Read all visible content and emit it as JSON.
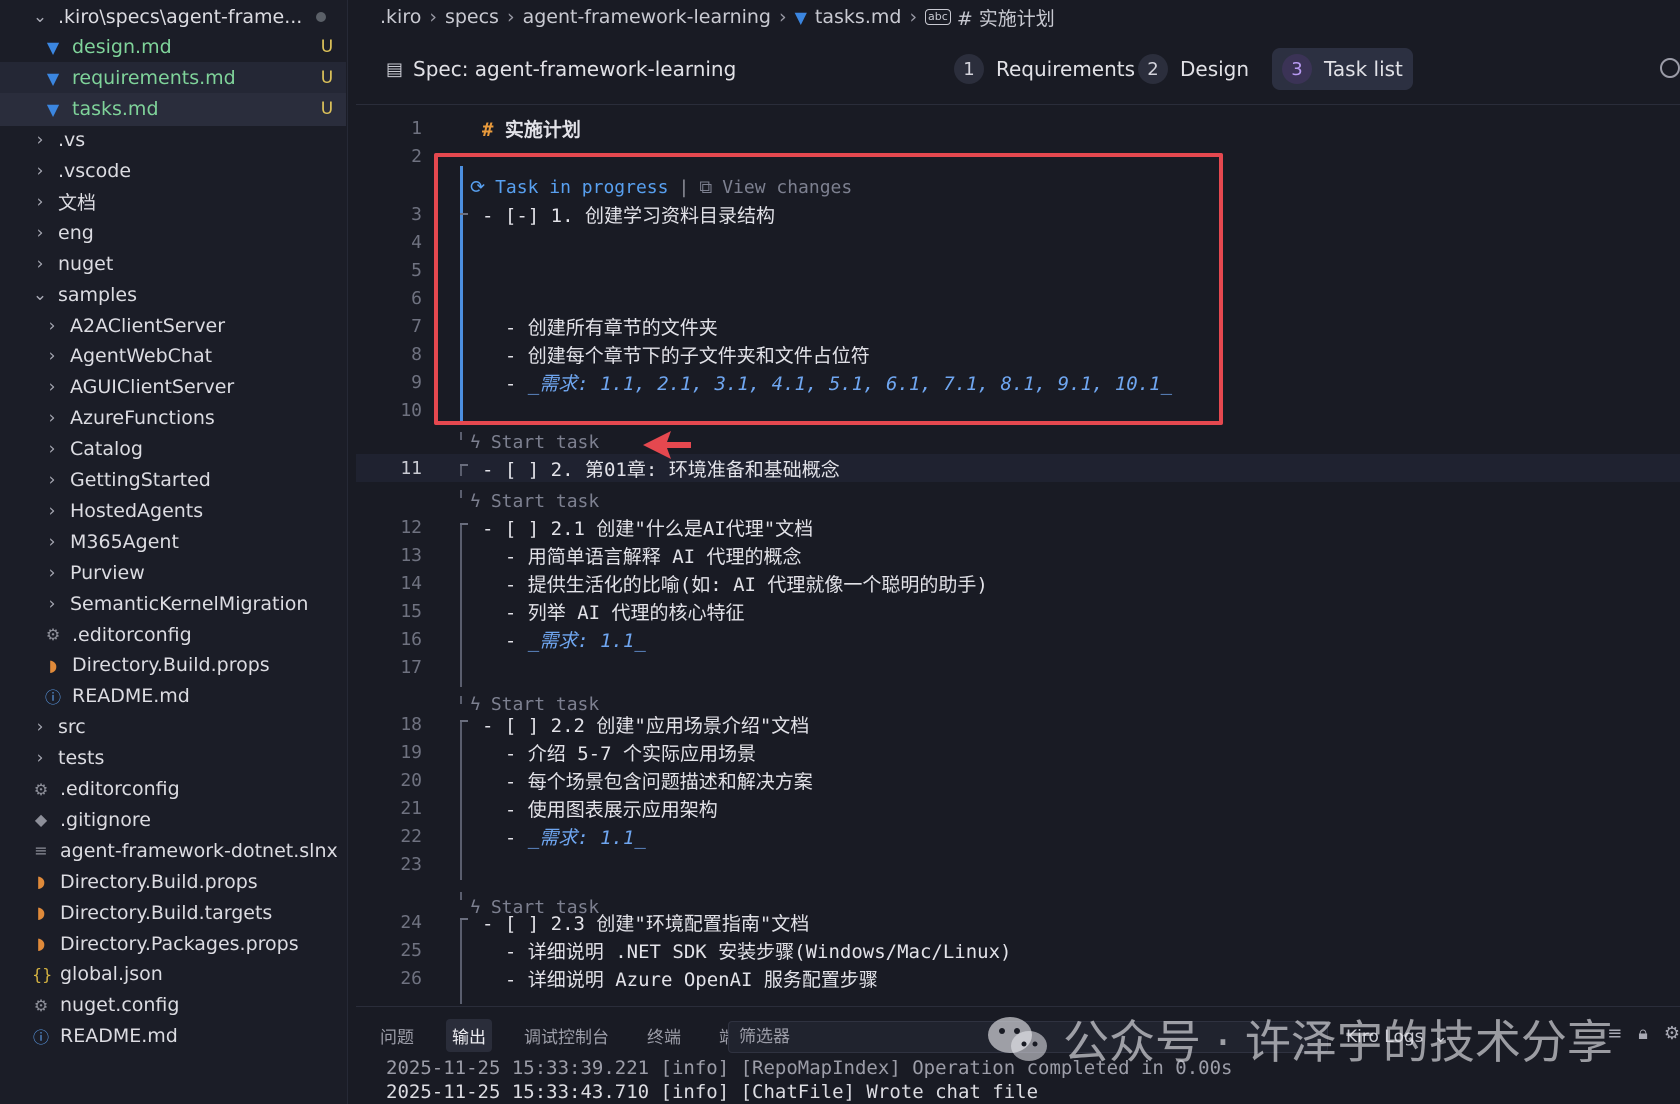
{
  "sidebar": {
    "items": [
      {
        "label": ".kiro\\specs\\agent-frame...",
        "kind": "folder-open",
        "indent": 1,
        "state": "modified"
      },
      {
        "label": "design.md",
        "kind": "md",
        "indent": 2,
        "badge": "U",
        "color": "green",
        "state": ""
      },
      {
        "label": "requirements.md",
        "kind": "md",
        "indent": 2,
        "badge": "U",
        "color": "green",
        "state": "hover"
      },
      {
        "label": "tasks.md",
        "kind": "md",
        "indent": 2,
        "badge": "U",
        "color": "green",
        "state": "active"
      },
      {
        "label": ".vs",
        "kind": "folder",
        "indent": 1
      },
      {
        "label": ".vscode",
        "kind": "folder",
        "indent": 1
      },
      {
        "label": "文档",
        "kind": "folder",
        "indent": 1
      },
      {
        "label": "eng",
        "kind": "folder",
        "indent": 1
      },
      {
        "label": "nuget",
        "kind": "folder",
        "indent": 1
      },
      {
        "label": "samples",
        "kind": "folder-open",
        "indent": 1
      },
      {
        "label": "A2AClientServer",
        "kind": "folder",
        "indent": 2
      },
      {
        "label": "AgentWebChat",
        "kind": "folder",
        "indent": 2
      },
      {
        "label": "AGUIClientServer",
        "kind": "folder",
        "indent": 2
      },
      {
        "label": "AzureFunctions",
        "kind": "folder",
        "indent": 2
      },
      {
        "label": "Catalog",
        "kind": "folder",
        "indent": 2
      },
      {
        "label": "GettingStarted",
        "kind": "folder",
        "indent": 2
      },
      {
        "label": "HostedAgents",
        "kind": "folder",
        "indent": 2
      },
      {
        "label": "M365Agent",
        "kind": "folder",
        "indent": 2
      },
      {
        "label": "Purview",
        "kind": "folder",
        "indent": 2
      },
      {
        "label": "SemanticKernelMigration",
        "kind": "folder",
        "indent": 2
      },
      {
        "label": ".editorconfig",
        "kind": "gear",
        "indent": 2
      },
      {
        "label": "Directory.Build.props",
        "kind": "rss",
        "indent": 2
      },
      {
        "label": "README.md",
        "kind": "info",
        "indent": 2
      },
      {
        "label": "src",
        "kind": "folder",
        "indent": 1
      },
      {
        "label": "tests",
        "kind": "folder",
        "indent": 1
      },
      {
        "label": ".editorconfig",
        "kind": "gear",
        "indent": 1
      },
      {
        "label": ".gitignore",
        "kind": "diamond",
        "indent": 1
      },
      {
        "label": "agent-framework-dotnet.slnx",
        "kind": "list",
        "indent": 1
      },
      {
        "label": "Directory.Build.props",
        "kind": "rss",
        "indent": 1
      },
      {
        "label": "Directory.Build.targets",
        "kind": "rss",
        "indent": 1
      },
      {
        "label": "Directory.Packages.props",
        "kind": "rss",
        "indent": 1
      },
      {
        "label": "global.json",
        "kind": "json",
        "indent": 1
      },
      {
        "label": "nuget.config",
        "kind": "gear",
        "indent": 1
      },
      {
        "label": "README.md",
        "kind": "info",
        "indent": 1
      }
    ]
  },
  "breadcrumb": {
    "parts": [
      ".kiro",
      "specs",
      "agent-framework-learning",
      "tasks.md"
    ],
    "last": "# 实施计划"
  },
  "spec": {
    "title": "Spec: agent-framework-learning",
    "steps": [
      {
        "num": "1",
        "label": "Requirements"
      },
      {
        "num": "2",
        "label": "Design"
      },
      {
        "num": "3",
        "label": "Task list"
      }
    ],
    "active_step": 3
  },
  "codelens": {
    "in_progress": "Task in progress",
    "separator": "|",
    "view_changes": "View changes",
    "start_task": "Start task"
  },
  "editor": {
    "lines": [
      {
        "n": "1",
        "text": "实施计划",
        "type": "h1"
      },
      {
        "n": "2",
        "text": ""
      },
      {
        "n": "3",
        "text": "- [-] 1. 创建学习资料目录结构"
      },
      {
        "n": "4",
        "text": ""
      },
      {
        "n": "5",
        "text": ""
      },
      {
        "n": "6",
        "text": ""
      },
      {
        "n": "7",
        "text": "  - 创建所有章节的文件夹"
      },
      {
        "n": "8",
        "text": "  - 创建每个章节下的子文件夹和文件占位符"
      },
      {
        "n": "9",
        "text": "  - ",
        "req": "_需求: 1.1, 2.1, 3.1, 4.1, 5.1, 6.1, 7.1, 8.1, 9.1, 10.1_"
      },
      {
        "n": "10",
        "text": ""
      },
      {
        "n": "11",
        "text": "- [ ] 2. 第01章: 环境准备和基础概念",
        "current": true
      },
      {
        "n": "12",
        "text": "- [ ] 2.1 创建\"什么是AI代理\"文档"
      },
      {
        "n": "13",
        "text": "  - 用简单语言解释 AI 代理的概念"
      },
      {
        "n": "14",
        "text": "  - 提供生活化的比喻(如: AI 代理就像一个聪明的助手)"
      },
      {
        "n": "15",
        "text": "  - 列举 AI 代理的核心特征"
      },
      {
        "n": "16",
        "text": "  - ",
        "req": "_需求: 1.1_"
      },
      {
        "n": "17",
        "text": ""
      },
      {
        "n": "18",
        "text": "- [ ] 2.2 创建\"应用场景介绍\"文档"
      },
      {
        "n": "19",
        "text": "  - 介绍 5-7 个实际应用场景"
      },
      {
        "n": "20",
        "text": "  - 每个场景包含问题描述和解决方案"
      },
      {
        "n": "21",
        "text": "  - 使用图表展示应用架构"
      },
      {
        "n": "22",
        "text": "  - ",
        "req": "_需求: 1.1_"
      },
      {
        "n": "23",
        "text": ""
      },
      {
        "n": "24",
        "text": "- [ ] 2.3 创建\"环境配置指南\"文档"
      },
      {
        "n": "25",
        "text": "  - 详细说明 .NET SDK 安装步骤(Windows/Mac/Linux)"
      },
      {
        "n": "26",
        "text": "  - 详细说明 Azure OpenAI 服务配置步骤"
      }
    ]
  },
  "panel": {
    "tabs": [
      "问题",
      "输出",
      "调试控制台",
      "终端",
      "端口"
    ],
    "active_tab": "输出",
    "filter_placeholder": "筛选器",
    "channel": "Kiro Logs",
    "logs": [
      "2025-11-25 15:33:39.221 [info] [RepoMapIndex] Operation completed in 0.00s",
      "2025-11-25 15:33:43.710 [info] [ChatFile] Wrote chat file"
    ]
  },
  "watermark": {
    "text": "公众号 · 许泽宇的技术分享"
  },
  "colors": {
    "highlight": "#e5484f",
    "accent": "#4c8fe0",
    "untracked": "#7fd39a",
    "badge": "#dec35a"
  }
}
